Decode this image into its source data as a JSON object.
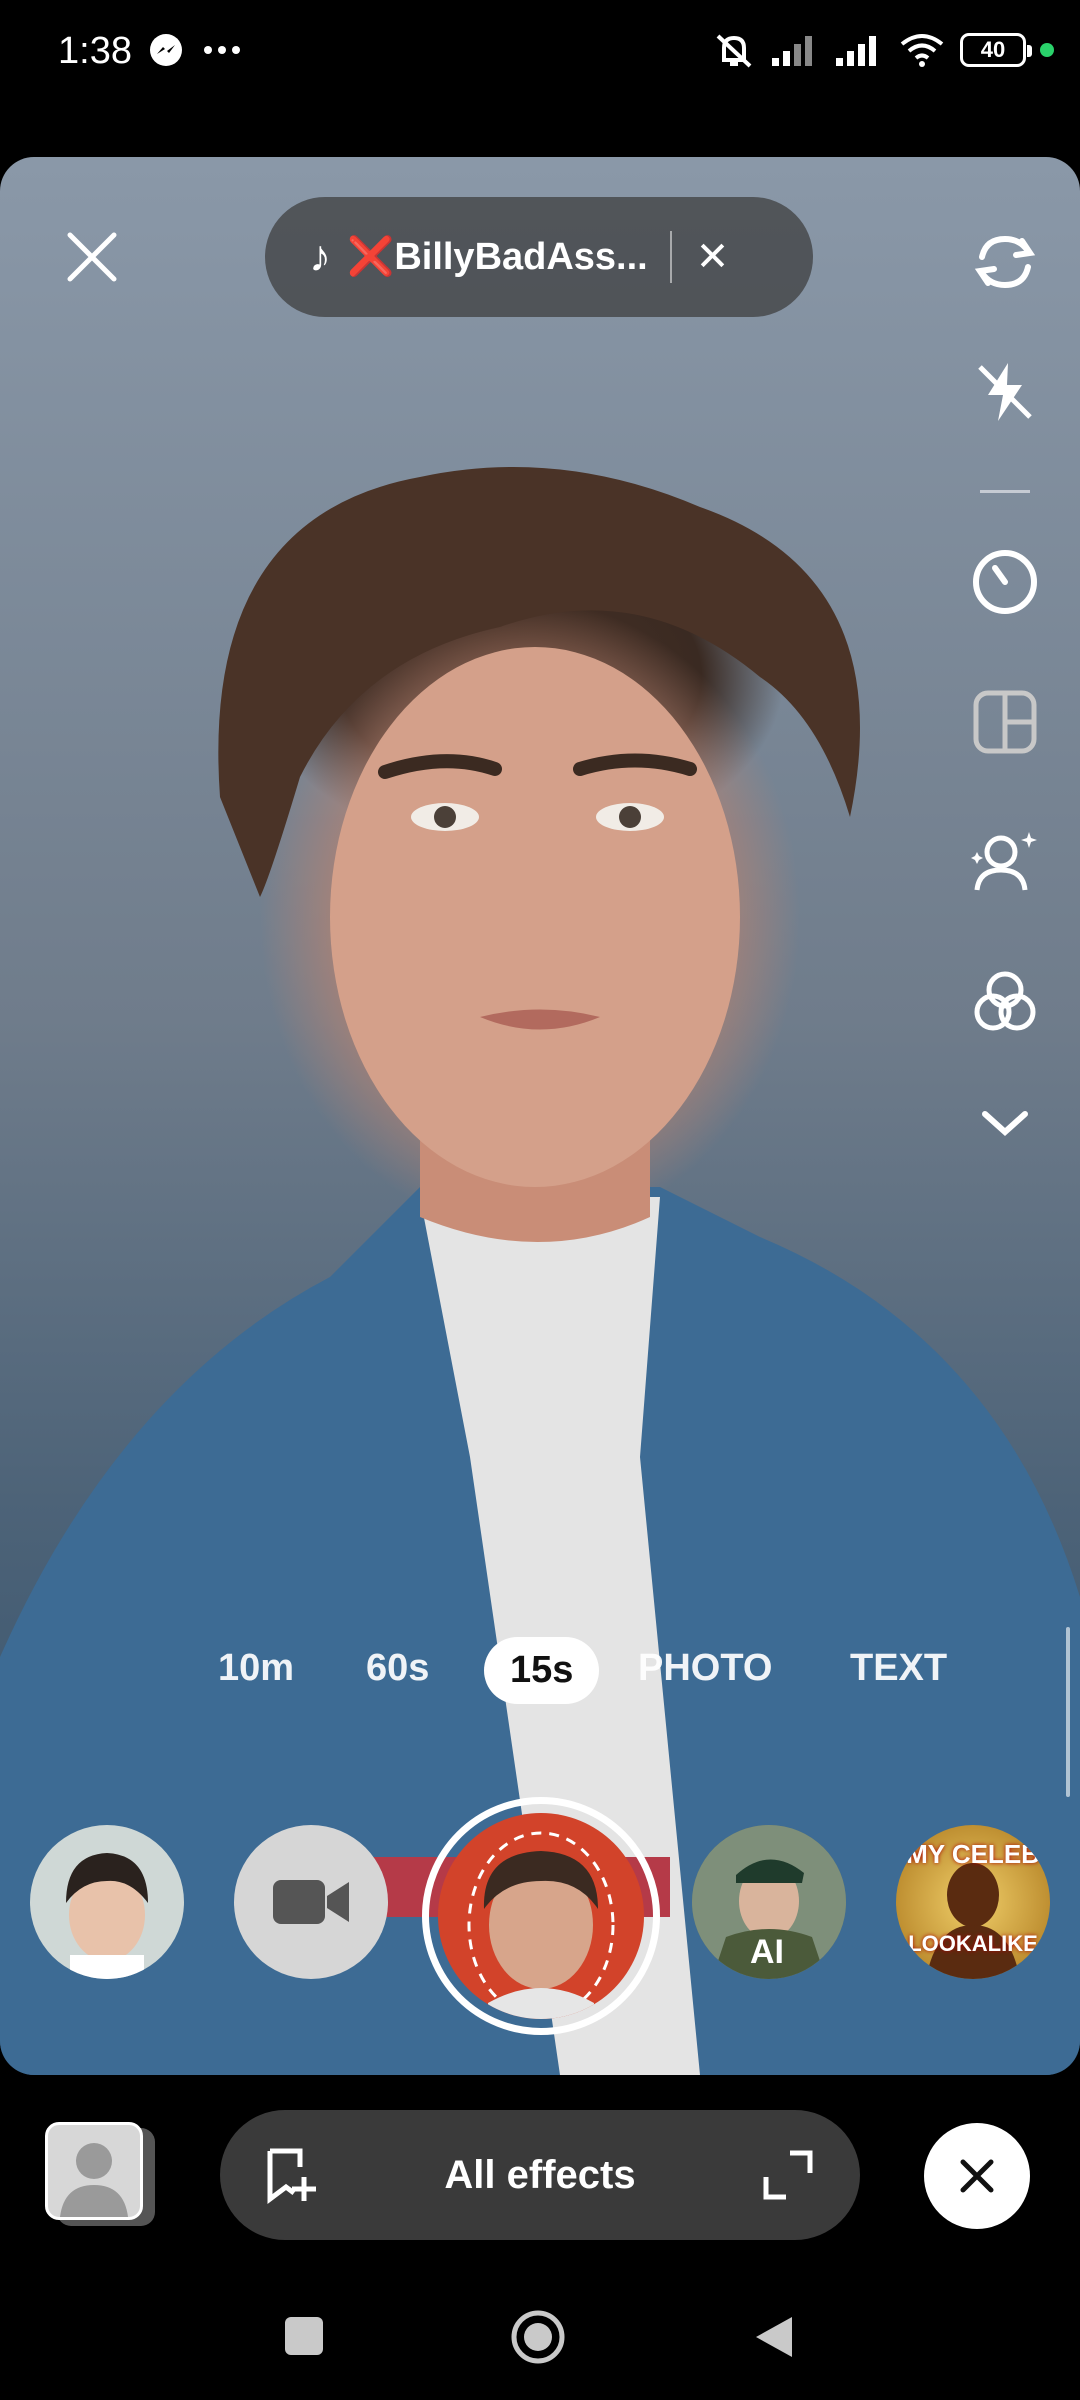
{
  "status_bar": {
    "time": "1:38",
    "battery": "40",
    "icons": [
      "messenger-icon",
      "more-dots-icon",
      "mute-icon",
      "signal-icon",
      "signal-icon",
      "wifi-icon",
      "battery-icon",
      "green-dot"
    ]
  },
  "music_pill": {
    "title": "❌BillyBadAss...",
    "icon": "music-note-icon"
  },
  "right_rail": [
    "flip-camera-icon",
    "flash-off-icon",
    "timer-icon",
    "layout-icon",
    "retouch-icon",
    "filters-icon",
    "chevron-down-icon"
  ],
  "modes": [
    {
      "label": "10m"
    },
    {
      "label": "60s"
    },
    {
      "label": "15s",
      "active": true
    },
    {
      "label": "PHOTO"
    },
    {
      "label": "TEXT"
    }
  ],
  "effects": [
    {
      "name": "portrait-effect",
      "icon": "face-thumb"
    },
    {
      "name": "video-effect",
      "icon": "video-camera-icon"
    },
    {
      "name": "selected-effect",
      "icon": "face-thumb-red"
    },
    {
      "name": "soldier-ai-effect",
      "badge": "AI"
    },
    {
      "name": "celeb-lookalike-effect",
      "line1": "MY CELEB",
      "line2": "LOOKALIKE"
    }
  ],
  "bottom_bar": {
    "effects_label": "All effects"
  },
  "colors": {
    "accent_red": "#e0312a",
    "pill_bg": "#3a3a3a"
  }
}
